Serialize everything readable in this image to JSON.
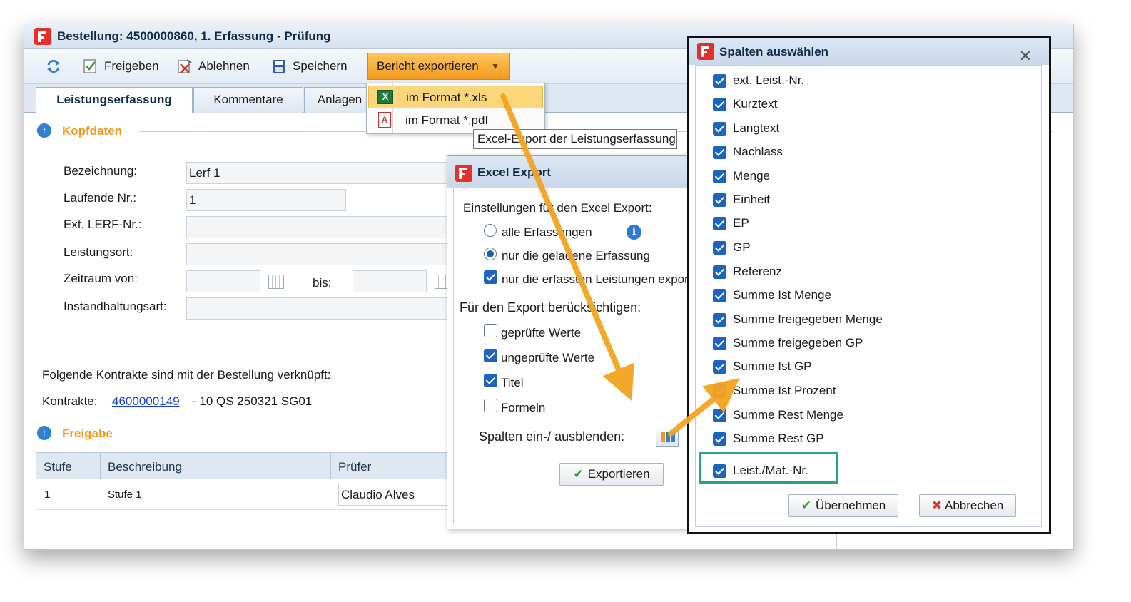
{
  "main": {
    "title": "Bestellung: 4500000860, 1. Erfassung - Prüfung",
    "toolbar": {
      "release": "Freigeben",
      "reject": "Ablehnen",
      "save": "Speichern",
      "export": "Bericht exportieren"
    },
    "tabs": [
      "Leistungserfassung",
      "Kommentare",
      "Anlagen"
    ],
    "kopf_title": "Kopfdaten",
    "fields": {
      "bezeichnung_label": "Bezeichnung:",
      "bezeichnung_value": "Lerf 1",
      "laufende_label": "Laufende Nr.:",
      "laufende_value": "1",
      "ext_label": "Ext. LERF-Nr.:",
      "ort_label": "Leistungsort:",
      "zeitraum_label": "Zeitraum von:",
      "bis_label": "bis:",
      "ia_label": "Instandhaltungsart:"
    },
    "kontrakte_text": "Folgende Kontrakte sind mit der Bestellung verknüpft:",
    "kontrakte_label": "Kontrakte:",
    "kontrakte_link": "4600000149",
    "kontrakte_suffix": "- 10 QS 250321 SG01",
    "freigabe_title": "Freigabe",
    "grid": {
      "columns": [
        "Stufe",
        "Beschreibung",
        "Prüfer"
      ],
      "rows": [
        [
          "1",
          "Stufe 1",
          "Claudio Alves"
        ]
      ]
    }
  },
  "menu": {
    "xls": "im Format *.xls",
    "pdf": "im Format *.pdf",
    "tooltip": "Excel-Export der Leistungserfassung"
  },
  "excel_dialog": {
    "title": "Excel Export",
    "settings_label": "Einstellungen für den Excel Export:",
    "radio_all": "alle Erfassungen",
    "radio_loaded": "nur die geladene Erfassung",
    "check_only": "nur die erfassten Leistungen exportieren",
    "consider_label": "Für den Export berücksichtigen:",
    "checks": [
      {
        "label": "geprüfte Werte",
        "checked": false
      },
      {
        "label": "ungeprüfte Werte",
        "checked": true
      },
      {
        "label": "Titel",
        "checked": true
      },
      {
        "label": "Formeln",
        "checked": false
      }
    ],
    "columns_label": "Spalten ein-/ ausblenden:",
    "export_button": "Exportieren"
  },
  "columns_dialog": {
    "title": "Spalten auswählen",
    "items": [
      "ext. Leist.-Nr.",
      "Kurztext",
      "Langtext",
      "Nachlass",
      "Menge",
      "Einheit",
      "EP",
      "GP",
      "Referenz",
      "Summe Ist Menge",
      "Summe freigegeben Menge",
      "Summe freigegeben GP",
      "Summe Ist GP",
      "Summe Ist Prozent",
      "Summe Rest Menge",
      "Summe Rest GP"
    ],
    "extra_item": "Leist./Mat.-Nr.",
    "apply_button": "Übernehmen",
    "cancel_button": "Abbrechen"
  },
  "colors": {
    "accent_orange": "#f39a1d",
    "checkbox_blue": "#1d64c2",
    "highlight_green": "#25a67c",
    "link_blue": "#1a3fd6"
  }
}
